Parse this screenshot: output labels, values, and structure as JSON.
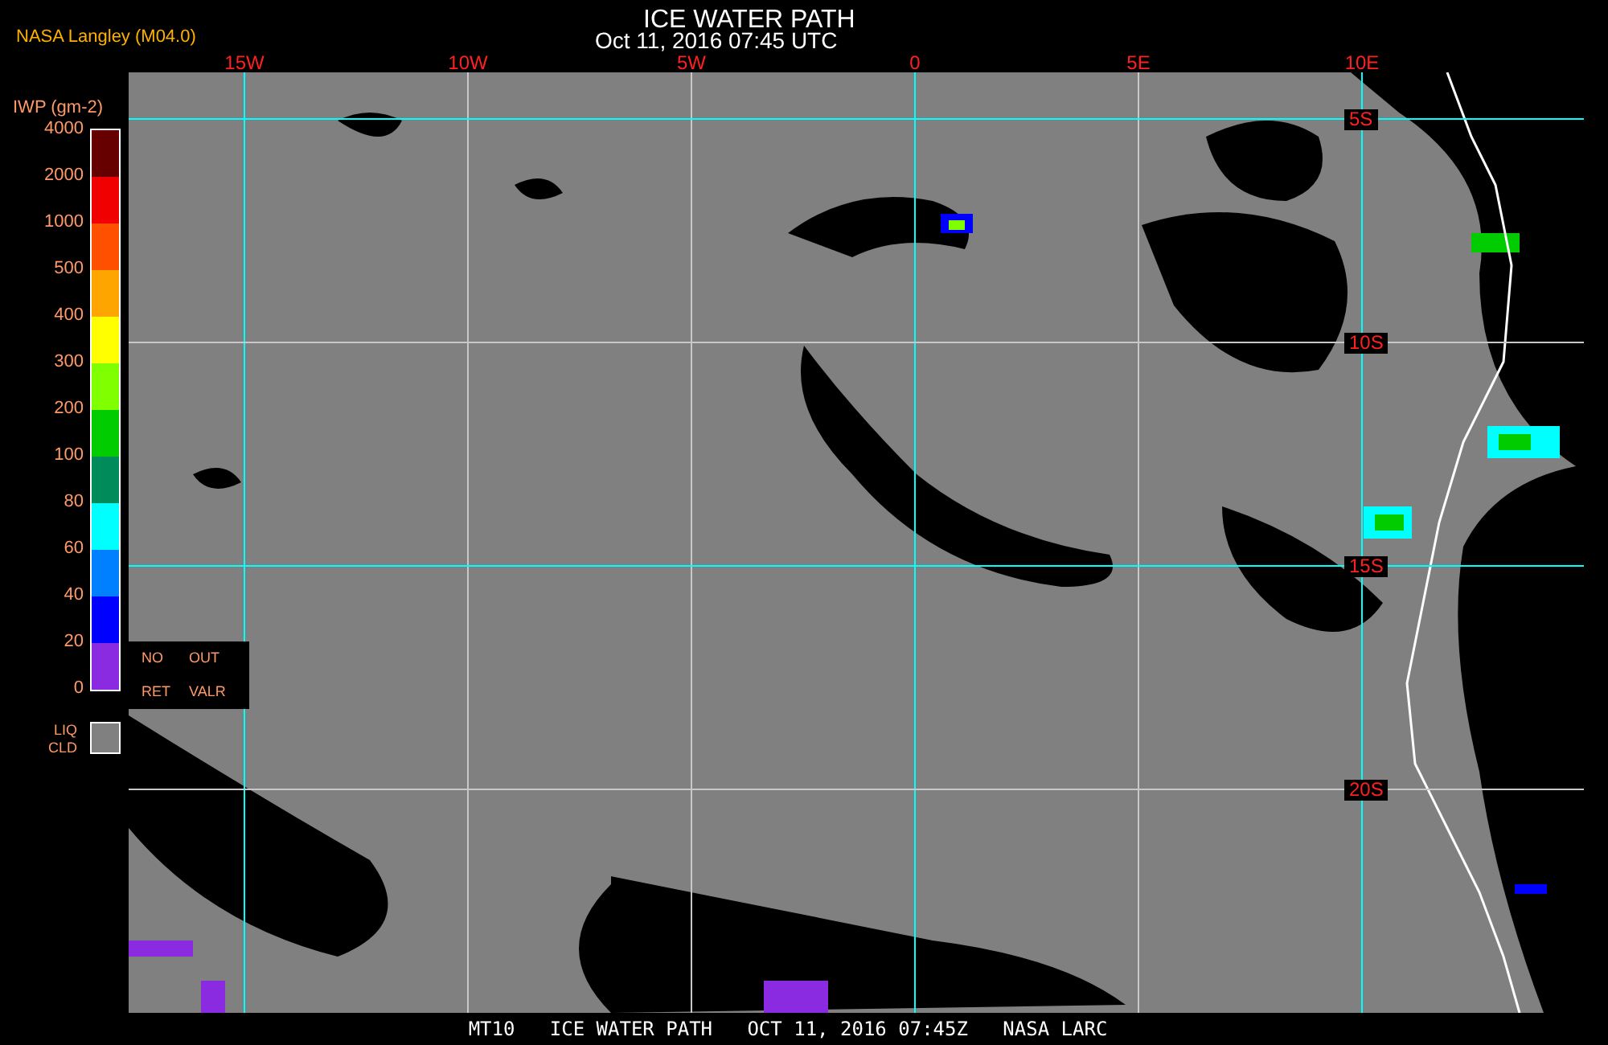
{
  "source_label": "NASA Langley (M04.0)",
  "title": "ICE WATER PATH",
  "subtitle": "Oct 11, 2016 07:45 UTC",
  "legend": {
    "unit": "IWP (gm-2)",
    "ticks": [
      "4000",
      "2000",
      "1000",
      "500",
      "400",
      "300",
      "200",
      "100",
      "80",
      "60",
      "40",
      "20",
      "0"
    ],
    "bins": [
      {
        "color": "#660000"
      },
      {
        "color": "#f00000"
      },
      {
        "color": "#ff5000"
      },
      {
        "color": "#ffa500"
      },
      {
        "color": "#ffff00"
      },
      {
        "color": "#80ff00"
      },
      {
        "color": "#00cc00"
      },
      {
        "color": "#008c5a"
      },
      {
        "color": "#00ffff"
      },
      {
        "color": "#0080ff"
      },
      {
        "color": "#0000ff"
      },
      {
        "color": "#8a2be2"
      }
    ],
    "no_retrieval": [
      "NO",
      "OUT",
      "RET",
      "VALR"
    ],
    "liquid_cloud": [
      "LIQ",
      "CLD"
    ]
  },
  "longitudes": [
    {
      "label": "15W",
      "kind": "major"
    },
    {
      "label": "10W",
      "kind": "minor"
    },
    {
      "label": "5W",
      "kind": "minor"
    },
    {
      "label": "0",
      "kind": "major"
    },
    {
      "label": "5E",
      "kind": "minor"
    },
    {
      "label": "10E",
      "kind": "major"
    }
  ],
  "latitudes": [
    {
      "label": "5S",
      "kind": "major"
    },
    {
      "label": "10S",
      "kind": "minor"
    },
    {
      "label": "15S",
      "kind": "major"
    },
    {
      "label": "20S",
      "kind": "minor"
    }
  ],
  "footer": "MT10   ICE WATER PATH   OCT 11, 2016 07:45Z   NASA LARC"
}
